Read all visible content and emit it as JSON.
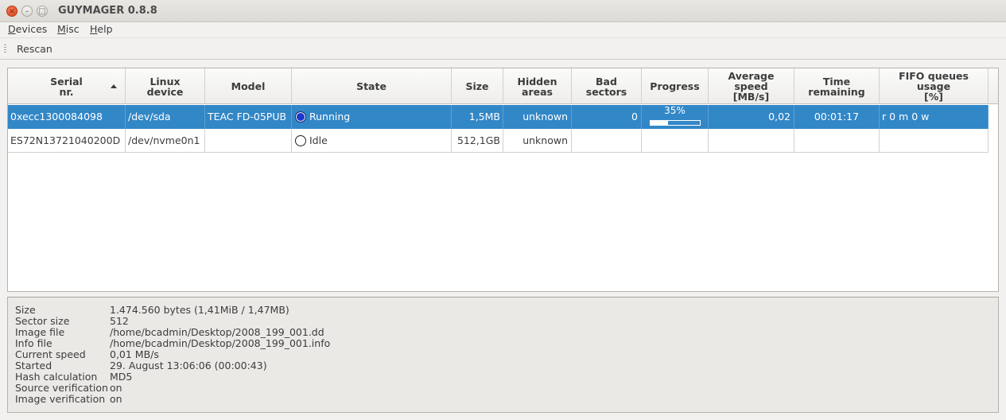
{
  "window": {
    "title": "GUYMAGER 0.8.8",
    "close_glyph": "×",
    "minimize_glyph": "–",
    "maximize_glyph": "□"
  },
  "menu": [
    {
      "label": "Devices",
      "accel": "D",
      "rest": "evices"
    },
    {
      "label": "Misc",
      "accel": "M",
      "rest": "isc"
    },
    {
      "label": "Help",
      "accel": "H",
      "rest": "elp"
    }
  ],
  "toolbar": {
    "rescan_label": "Rescan"
  },
  "table": {
    "columns": [
      "Serial\nnr.",
      "Linux\ndevice",
      "Model",
      "State",
      "Size",
      "Hidden\nareas",
      "Bad\nsectors",
      "Progress",
      "Average\nspeed\n[MB/s]",
      "Time\nremaining",
      "FIFO queues\nusage\n[%]"
    ],
    "rows": [
      {
        "serial": "0xecc1300084098",
        "device": "/dev/sda",
        "model": "TEAC FD-05PUB",
        "state": "Running",
        "state_color": "#1b37c9",
        "size": "1,5MB",
        "hidden": "unknown",
        "bad": "0",
        "progress_label": "35%",
        "progress_fraction": 0.35,
        "speed": "0,02",
        "remaining": "00:01:17",
        "fifo": "r 0 m 0 w",
        "selected": true
      },
      {
        "serial": "ES72N13721040200D",
        "device": "/dev/nvme0n1",
        "model": "",
        "state": "Idle",
        "state_color": "#ffffff",
        "size": "512,1GB",
        "hidden": "unknown",
        "bad": "",
        "progress_label": "",
        "speed": "",
        "remaining": "",
        "fifo": "",
        "selected": false
      }
    ]
  },
  "info": [
    {
      "key": "Size",
      "value": "1.474.560 bytes (1,41MiB / 1,47MB)"
    },
    {
      "key": "Sector size",
      "value": "512"
    },
    {
      "key": "Image file",
      "value": "/home/bcadmin/Desktop/2008_199_001.dd"
    },
    {
      "key": "Info file",
      "value": "/home/bcadmin/Desktop/2008_199_001.info"
    },
    {
      "key": "Current speed",
      "value": "0,01 MB/s"
    },
    {
      "key": "Started",
      "value": "29. August 13:06:06 (00:00:43)"
    },
    {
      "key": "Hash calculation",
      "value": "MD5"
    },
    {
      "key": "Source verification",
      "value": "on"
    },
    {
      "key": "Image verification",
      "value": "on"
    }
  ],
  "colors": {
    "selection": "#3287c7",
    "close_button": "#d8421a"
  }
}
